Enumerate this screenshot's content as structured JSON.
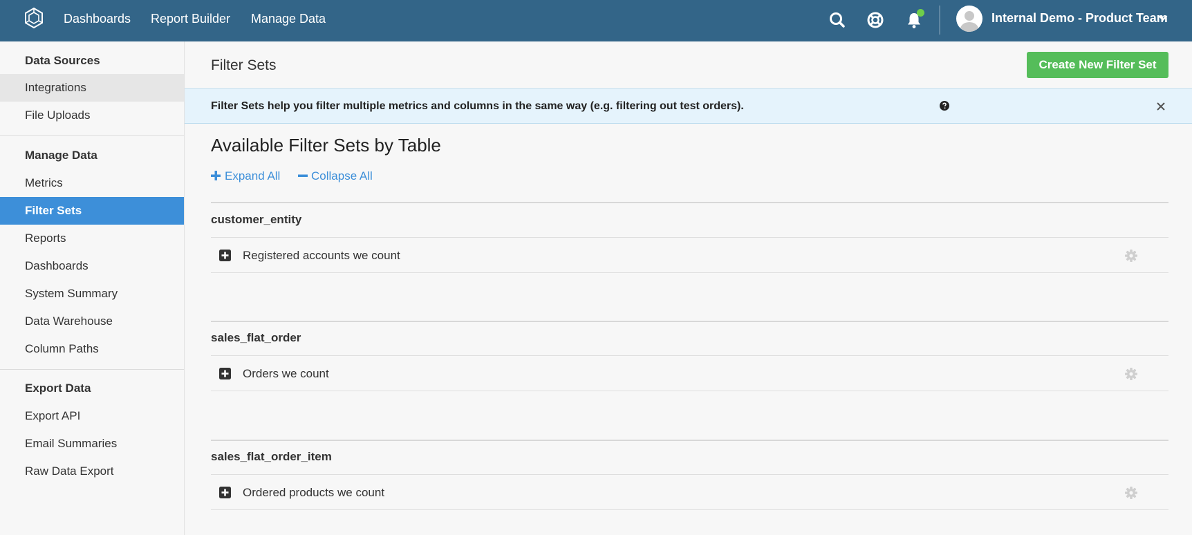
{
  "topnav": {
    "links": [
      "Dashboards",
      "Report Builder",
      "Manage Data"
    ],
    "account_name": "Internal Demo - Product Team"
  },
  "sidebar": {
    "sections": [
      {
        "heading": "Data Sources",
        "items": [
          "Integrations",
          "File Uploads"
        ]
      },
      {
        "heading": "Manage Data",
        "items": [
          "Metrics",
          "Filter Sets",
          "Reports",
          "Dashboards",
          "System Summary",
          "Data Warehouse",
          "Column Paths"
        ]
      },
      {
        "heading": "Export Data",
        "items": [
          "Export API",
          "Email Summaries",
          "Raw Data Export"
        ]
      }
    ],
    "active_item": "Filter Sets",
    "hover_item": "Integrations"
  },
  "main": {
    "page_title": "Filter Sets",
    "create_button": "Create New Filter Set",
    "banner_text": "Filter Sets help you filter multiple metrics and columns in the same way (e.g. filtering out test orders).",
    "section_title": "Available Filter Sets by Table",
    "expand_all": "Expand All",
    "collapse_all": "Collapse All",
    "tables": [
      {
        "name": "customer_entity",
        "filter_sets": [
          "Registered accounts we count"
        ]
      },
      {
        "name": "sales_flat_order",
        "filter_sets": [
          "Orders we count"
        ]
      },
      {
        "name": "sales_flat_order_item",
        "filter_sets": [
          "Ordered products we count"
        ]
      }
    ]
  },
  "colors": {
    "topbar": "#336588",
    "accent_blue": "#3d8fd9",
    "create_green": "#55bd5a",
    "banner_bg": "#e5f3fc",
    "notification_dot": "#6fcf4a"
  },
  "icons": [
    "logo-icon",
    "search-icon",
    "help-lifebuoy-icon",
    "bell-icon",
    "avatar-icon",
    "chevron-down-icon",
    "question-circle-icon",
    "close-icon",
    "plus-icon",
    "minus-icon",
    "plus-square-icon",
    "gear-icon"
  ]
}
